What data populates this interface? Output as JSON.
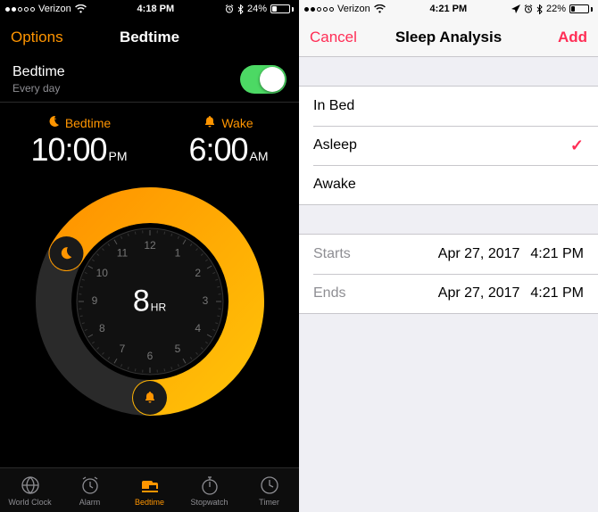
{
  "left": {
    "status": {
      "carrier": "Verizon",
      "time": "4:18 PM",
      "battery_pct": "24%",
      "battery_fill": 24
    },
    "nav": {
      "left": "Options",
      "title": "Bedtime"
    },
    "header": {
      "title": "Bedtime",
      "subtitle": "Every day"
    },
    "bedtime": {
      "label": "Bedtime",
      "time": "10:00",
      "ampm": "PM"
    },
    "wake": {
      "label": "Wake",
      "time": "6:00",
      "ampm": "AM"
    },
    "duration": {
      "num": "8",
      "unit": "HR"
    },
    "clock_numbers": [
      "12",
      "1",
      "2",
      "3",
      "4",
      "5",
      "6",
      "7",
      "8",
      "9",
      "10",
      "11"
    ],
    "tabs": {
      "worldclock": "World Clock",
      "alarm": "Alarm",
      "bedtime": "Bedtime",
      "stopwatch": "Stopwatch",
      "timer": "Timer"
    }
  },
  "right": {
    "status": {
      "carrier": "Verizon",
      "time": "4:21 PM",
      "battery_pct": "22%",
      "battery_fill": 22
    },
    "nav": {
      "left": "Cancel",
      "title": "Sleep Analysis",
      "right": "Add"
    },
    "options": {
      "in_bed": "In Bed",
      "asleep": "Asleep",
      "awake": "Awake"
    },
    "selected": "asleep",
    "range": {
      "starts": {
        "label": "Starts",
        "date": "Apr 27, 2017",
        "time": "4:21 PM"
      },
      "ends": {
        "label": "Ends",
        "date": "Apr 27, 2017",
        "time": "4:21 PM"
      }
    }
  }
}
